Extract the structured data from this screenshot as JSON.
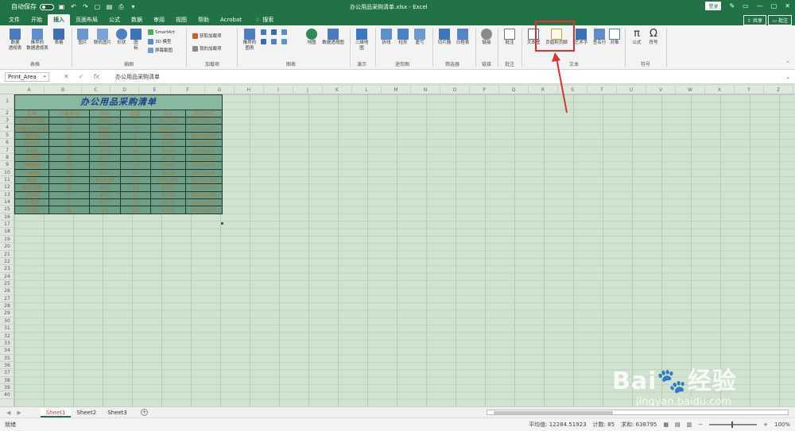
{
  "titlebar": {
    "autosave": "自动保存",
    "autosave_state": "关",
    "filename": "办公用品采购清单.xlsx - Excel",
    "login": "登录"
  },
  "tabs": [
    "文件",
    "开始",
    "插入",
    "页面布局",
    "公式",
    "数据",
    "审阅",
    "视图",
    "帮助",
    "Acrobat"
  ],
  "active_tab": "插入",
  "search": "搜索",
  "share": "共享",
  "comment": "批注",
  "ribbon": {
    "pivot": "数据\n透视表",
    "rec_pivot": "推荐的\n数据透视表",
    "table": "表格",
    "g_tables": "表格",
    "picture": "图片",
    "online_pic": "联机图片",
    "shapes": "形状",
    "icons": "图\n标",
    "smartart": "SmartArt",
    "model3d": "3D 模型",
    "screenshot": "屏幕截图",
    "g_illus": "插图",
    "get_addin": "获取加载项",
    "my_addin": "我的加载项",
    "g_addin": "加载项",
    "rec_chart": "推荐的\n图表",
    "map": "地图",
    "pivot_chart": "数据透视图",
    "g_charts": "图表",
    "map3d": "三维地\n图",
    "g_tour": "演示",
    "line": "折线",
    "column": "柱形",
    "winloss": "盈亏",
    "g_spark": "迷你图",
    "slicer": "切片器",
    "timeline": "日程表",
    "g_filter": "筛选器",
    "link": "链接",
    "g_link": "链接",
    "comment_btn": "批注",
    "g_comment": "批注",
    "textbox": "文本框",
    "header_footer": "页眉和页脚",
    "wordart": "艺术字",
    "signature": "签名行",
    "object": "对象",
    "g_text": "文本",
    "equation": "公式",
    "symbol": "符号",
    "g_symbol": "符号"
  },
  "namebox": "Print_Area",
  "formula": "办公用品采购清单",
  "columns": [
    "A",
    "B",
    "C",
    "D",
    "E",
    "F",
    "G",
    "H",
    "I",
    "J",
    "K",
    "L",
    "M",
    "N",
    "O",
    "P",
    "Q",
    "R",
    "S",
    "T",
    "U",
    "V",
    "W",
    "X",
    "Y",
    "Z"
  ],
  "rows": [
    "1",
    "2",
    "3",
    "4",
    "5",
    "6",
    "7",
    "8",
    "9",
    "10",
    "11",
    "12",
    "13",
    "14",
    "15",
    "16",
    "17",
    "18",
    "19",
    "20",
    "21",
    "22",
    "23",
    "24",
    "25",
    "26",
    "27",
    "28",
    "29",
    "30",
    "31",
    "32",
    "33",
    "34",
    "35",
    "36",
    "37",
    "38",
    "39",
    "40",
    "41"
  ],
  "sheet_title": "办公用品采购清单",
  "table_header": [
    "名称",
    "计量单位",
    "单价",
    "数量",
    "合计",
    "购买时间"
  ],
  "table_rows": [
    [
      "针式打印机",
      "台",
      "¥840",
      "3",
      "¥2,520",
      "2015/3/20"
    ],
    [
      "喷墨式打印机",
      "台",
      "¥680",
      "3",
      "¥2,040",
      "2015/3/20"
    ],
    [
      "复印机",
      "台",
      "¥951",
      "1",
      "¥951",
      "2015/3/30"
    ],
    [
      "扫描仪",
      "台",
      "¥345",
      "1",
      "¥345",
      "2015/3/30"
    ],
    [
      "A4纸",
      "包",
      "¥15",
      "10",
      "¥150",
      "2015/4/1"
    ],
    [
      "三联纸",
      "包",
      "¥17",
      "10",
      "¥170",
      "2015/4/2"
    ],
    [
      "两联纸",
      "包",
      "¥16",
      "10",
      "¥160",
      "2015/4/3"
    ],
    [
      "一联纸",
      "包",
      "¥15",
      "10",
      "¥150",
      "2015/4/4"
    ],
    [
      "电脑",
      "台",
      "¥3,840",
      "20",
      "¥76,800",
      "2015/2/20"
    ],
    [
      "电话座机",
      "台",
      "¥35",
      "15",
      "¥525",
      "2015/4/10"
    ],
    [
      "订书机",
      "个",
      "¥25",
      "15",
      "¥375",
      "2015/4/15"
    ],
    [
      "计算器",
      "个",
      "¥10",
      "25",
      "¥250",
      "2015/4/15"
    ],
    [
      "订书针",
      "盒",
      "¥3",
      "50",
      "¥150",
      "2015/4/15"
    ]
  ],
  "sheets": [
    "Sheet1",
    "Sheet2",
    "Sheet3"
  ],
  "status": {
    "ready": "就绪",
    "average": "平均值: 12284.51923",
    "count": "计数: 85",
    "sum": "求和: 638795",
    "zoom": "100%"
  },
  "watermark": {
    "main": "Bai🐾经验",
    "sub": "jingyan.baidu.com"
  },
  "colors": {
    "title_bar": "#217346",
    "highlight": "#e03030",
    "sheet_bg": "#cfe3cf"
  }
}
